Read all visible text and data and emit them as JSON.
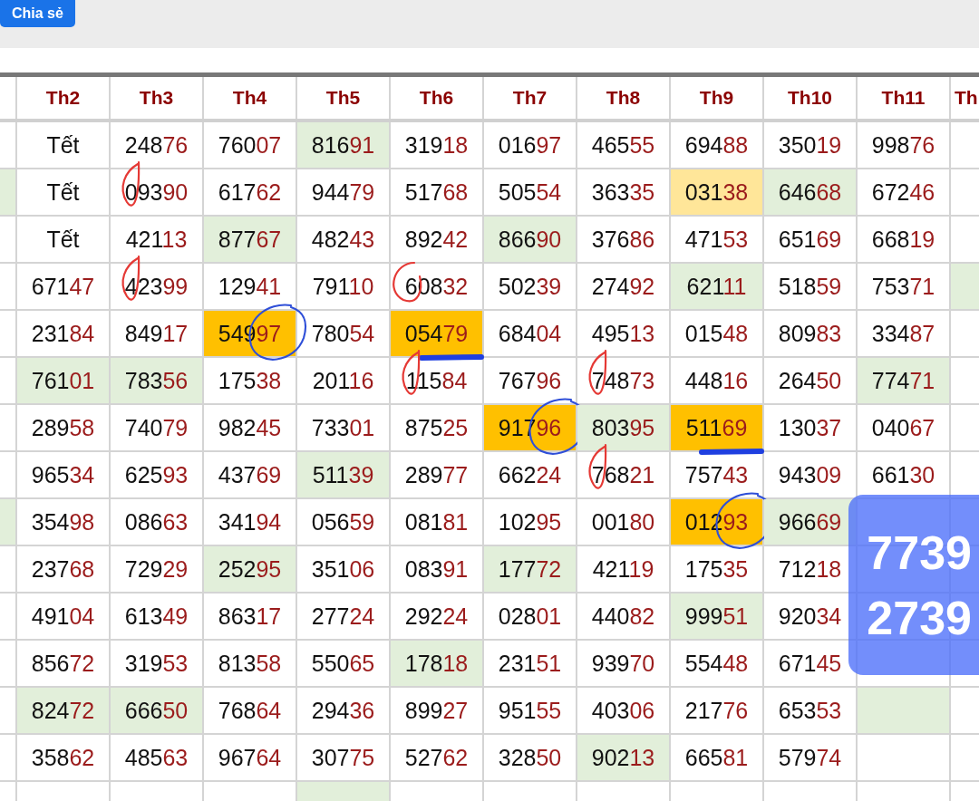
{
  "toolbar": {
    "share_button": "Chia sẻ"
  },
  "table": {
    "columns": [
      {},
      {
        "label": "Th2"
      },
      {
        "label": "Th3"
      },
      {
        "label": "Th4"
      },
      {
        "label": "Th5"
      },
      {
        "label": "Th6"
      },
      {
        "label": "Th7"
      },
      {
        "label": "Th8"
      },
      {
        "label": "Th9"
      },
      {
        "label": "Th10"
      },
      {
        "label": "Th11"
      },
      {
        "label": "Th"
      }
    ],
    "rows": [
      {
        "cells": [
          {},
          {
            "text": "Tết",
            "kind": "holiday"
          },
          {
            "text": "24876",
            "kind": "number"
          },
          {
            "text": "76007",
            "kind": "number"
          },
          {
            "text": "81691",
            "kind": "number",
            "color": "#e2efda"
          },
          {
            "text": "31918",
            "kind": "number"
          },
          {
            "text": "01697",
            "kind": "number"
          },
          {
            "text": "46555",
            "kind": "number"
          },
          {
            "text": "69488",
            "kind": "number"
          },
          {
            "text": "35019",
            "kind": "number"
          },
          {
            "text": "99876",
            "kind": "number"
          },
          {}
        ]
      },
      {
        "cells": [
          {
            "color": "#e2efda"
          },
          {
            "text": "Tết",
            "kind": "holiday"
          },
          {
            "text": "09390",
            "kind": "number",
            "mark": {
              "kind": "bracket",
              "color": "#e53935"
            }
          },
          {
            "text": "61762",
            "kind": "number"
          },
          {
            "text": "94479",
            "kind": "number"
          },
          {
            "text": "51768",
            "kind": "number"
          },
          {
            "text": "50554",
            "kind": "number"
          },
          {
            "text": "36335",
            "kind": "number"
          },
          {
            "text": "03138",
            "kind": "number",
            "color": "#ffe699"
          },
          {
            "text": "64668",
            "kind": "number",
            "color": "#e2efda"
          },
          {
            "text": "67246",
            "kind": "number"
          },
          {}
        ]
      },
      {
        "cells": [
          {},
          {
            "text": "Tết",
            "kind": "holiday"
          },
          {
            "text": "42113",
            "kind": "number"
          },
          {
            "text": "87767",
            "kind": "number",
            "color": "#e2efda"
          },
          {
            "text": "48243",
            "kind": "number"
          },
          {
            "text": "89242",
            "kind": "number"
          },
          {
            "text": "86690",
            "kind": "number",
            "color": "#e2efda"
          },
          {
            "text": "37686",
            "kind": "number"
          },
          {
            "text": "47153",
            "kind": "number"
          },
          {
            "text": "65169",
            "kind": "number"
          },
          {
            "text": "66819",
            "kind": "number"
          },
          {}
        ]
      },
      {
        "cells": [
          {},
          {
            "text": "67147",
            "kind": "number"
          },
          {
            "text": "42399",
            "kind": "number",
            "mark": {
              "kind": "bracket",
              "color": "#e53935"
            }
          },
          {
            "text": "12941",
            "kind": "number"
          },
          {
            "text": "79110",
            "kind": "number"
          },
          {
            "text": "60832",
            "kind": "number",
            "mark": {
              "kind": "headcircle",
              "color": "#e53935"
            }
          },
          {
            "text": "50239",
            "kind": "number"
          },
          {
            "text": "27492",
            "kind": "number"
          },
          {
            "text": "62111",
            "kind": "number",
            "color": "#e2efda"
          },
          {
            "text": "51859",
            "kind": "number"
          },
          {
            "text": "75371",
            "kind": "number"
          },
          {
            "color": "#e2efda"
          }
        ]
      },
      {
        "cells": [
          {},
          {
            "text": "23184",
            "kind": "number"
          },
          {
            "text": "84917",
            "kind": "number"
          },
          {
            "text": "54997",
            "kind": "number",
            "color": "#ffc000",
            "mark": {
              "kind": "tailcircle",
              "color": "#2f4fd8"
            }
          },
          {
            "text": "78054",
            "kind": "number"
          },
          {
            "text": "05479",
            "kind": "number",
            "color": "#ffc000",
            "mark": {
              "kind": "underline",
              "color": "#1f3fe0"
            }
          },
          {
            "text": "68404",
            "kind": "number"
          },
          {
            "text": "49513",
            "kind": "number"
          },
          {
            "text": "01548",
            "kind": "number"
          },
          {
            "text": "80983",
            "kind": "number"
          },
          {
            "text": "33487",
            "kind": "number"
          },
          {}
        ]
      },
      {
        "cells": [
          {},
          {
            "text": "76101",
            "kind": "number",
            "color": "#e2efda"
          },
          {
            "text": "78356",
            "kind": "number",
            "color": "#e2efda"
          },
          {
            "text": "17538",
            "kind": "number"
          },
          {
            "text": "20116",
            "kind": "number"
          },
          {
            "text": "11584",
            "kind": "number",
            "mark": {
              "kind": "bracket",
              "color": "#e53935"
            }
          },
          {
            "text": "76796",
            "kind": "number"
          },
          {
            "text": "74873",
            "kind": "number",
            "mark": {
              "kind": "bracket",
              "color": "#e53935"
            }
          },
          {
            "text": "44816",
            "kind": "number"
          },
          {
            "text": "26450",
            "kind": "number"
          },
          {
            "text": "77471",
            "kind": "number",
            "color": "#e2efda"
          },
          {}
        ]
      },
      {
        "cells": [
          {},
          {
            "text": "28958",
            "kind": "number"
          },
          {
            "text": "74079",
            "kind": "number"
          },
          {
            "text": "98245",
            "kind": "number"
          },
          {
            "text": "73301",
            "kind": "number"
          },
          {
            "text": "87525",
            "kind": "number"
          },
          {
            "text": "91796",
            "kind": "number",
            "color": "#ffc000",
            "mark": {
              "kind": "tailcircle",
              "color": "#2f4fd8"
            }
          },
          {
            "text": "80395",
            "kind": "number",
            "color": "#e2efda"
          },
          {
            "text": "51169",
            "kind": "number",
            "color": "#ffc000",
            "mark": {
              "kind": "underline",
              "color": "#1f3fe0"
            }
          },
          {
            "text": "13037",
            "kind": "number"
          },
          {
            "text": "04067",
            "kind": "number"
          },
          {}
        ]
      },
      {
        "cells": [
          {},
          {
            "text": "96534",
            "kind": "number"
          },
          {
            "text": "62593",
            "kind": "number"
          },
          {
            "text": "43769",
            "kind": "number"
          },
          {
            "text": "51139",
            "kind": "number",
            "color": "#e2efda"
          },
          {
            "text": "28977",
            "kind": "number"
          },
          {
            "text": "66224",
            "kind": "number"
          },
          {
            "text": "76821",
            "kind": "number",
            "mark": {
              "kind": "bracket",
              "color": "#e53935"
            }
          },
          {
            "text": "75743",
            "kind": "number"
          },
          {
            "text": "94309",
            "kind": "number"
          },
          {
            "text": "66130",
            "kind": "number"
          },
          {}
        ]
      },
      {
        "cells": [
          {
            "color": "#e2efda"
          },
          {
            "text": "35498",
            "kind": "number"
          },
          {
            "text": "08663",
            "kind": "number"
          },
          {
            "text": "34194",
            "kind": "number"
          },
          {
            "text": "05659",
            "kind": "number"
          },
          {
            "text": "08181",
            "kind": "number"
          },
          {
            "text": "10295",
            "kind": "number"
          },
          {
            "text": "00180",
            "kind": "number"
          },
          {
            "text": "01293",
            "kind": "number",
            "color": "#ffc000",
            "mark": {
              "kind": "tailcircle",
              "color": "#2f4fd8"
            }
          },
          {
            "text": "96669",
            "kind": "number",
            "color": "#e2efda"
          },
          {},
          {}
        ]
      },
      {
        "cells": [
          {},
          {
            "text": "23768",
            "kind": "number"
          },
          {
            "text": "72929",
            "kind": "number"
          },
          {
            "text": "25295",
            "kind": "number",
            "color": "#e2efda"
          },
          {
            "text": "35106",
            "kind": "number"
          },
          {
            "text": "08391",
            "kind": "number"
          },
          {
            "text": "17772",
            "kind": "number",
            "color": "#e2efda"
          },
          {
            "text": "42119",
            "kind": "number"
          },
          {
            "text": "17535",
            "kind": "number"
          },
          {
            "text": "71218",
            "kind": "number"
          },
          {},
          {}
        ]
      },
      {
        "cells": [
          {},
          {
            "text": "49104",
            "kind": "number"
          },
          {
            "text": "61349",
            "kind": "number"
          },
          {
            "text": "86317",
            "kind": "number"
          },
          {
            "text": "27724",
            "kind": "number"
          },
          {
            "text": "29224",
            "kind": "number"
          },
          {
            "text": "02801",
            "kind": "number"
          },
          {
            "text": "44082",
            "kind": "number"
          },
          {
            "text": "99951",
            "kind": "number",
            "color": "#e2efda"
          },
          {
            "text": "92034",
            "kind": "number"
          },
          {},
          {}
        ]
      },
      {
        "cells": [
          {},
          {
            "text": "85672",
            "kind": "number"
          },
          {
            "text": "31953",
            "kind": "number"
          },
          {
            "text": "81358",
            "kind": "number"
          },
          {
            "text": "55065",
            "kind": "number"
          },
          {
            "text": "17818",
            "kind": "number",
            "color": "#e2efda"
          },
          {
            "text": "23151",
            "kind": "number"
          },
          {
            "text": "93970",
            "kind": "number"
          },
          {
            "text": "55448",
            "kind": "number"
          },
          {
            "text": "67145",
            "kind": "number"
          },
          {},
          {}
        ]
      },
      {
        "cells": [
          {},
          {
            "text": "82472",
            "kind": "number",
            "color": "#e2efda"
          },
          {
            "text": "66650",
            "kind": "number",
            "color": "#e2efda"
          },
          {
            "text": "76864",
            "kind": "number"
          },
          {
            "text": "29436",
            "kind": "number"
          },
          {
            "text": "89927",
            "kind": "number"
          },
          {
            "text": "95155",
            "kind": "number"
          },
          {
            "text": "40306",
            "kind": "number"
          },
          {
            "text": "21776",
            "kind": "number"
          },
          {
            "text": "65353",
            "kind": "number"
          },
          {
            "color": "#e2efda"
          },
          {}
        ]
      },
      {
        "cells": [
          {},
          {
            "text": "35862",
            "kind": "number"
          },
          {
            "text": "48563",
            "kind": "number"
          },
          {
            "text": "96764",
            "kind": "number"
          },
          {
            "text": "30775",
            "kind": "number"
          },
          {
            "text": "52762",
            "kind": "number"
          },
          {
            "text": "32850",
            "kind": "number"
          },
          {
            "text": "90213",
            "kind": "number",
            "color": "#e2efda"
          },
          {
            "text": "66581",
            "kind": "number"
          },
          {
            "text": "57974",
            "kind": "number"
          },
          {},
          {}
        ]
      },
      {
        "cells": [
          {},
          {},
          {},
          {},
          {
            "color": "#e2efda"
          },
          {},
          {},
          {},
          {},
          {},
          {},
          {}
        ]
      }
    ]
  },
  "overlay": {
    "lines": [
      "7739",
      "2739"
    ]
  }
}
